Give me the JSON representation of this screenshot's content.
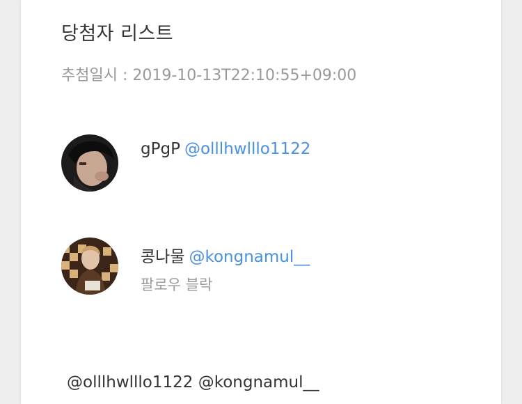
{
  "list": {
    "title": "당첨자 리스트",
    "draw_date": "추첨일시 : 2019-10-13T22:10:55+09:00"
  },
  "winners": [
    {
      "name": "gPgP",
      "handle": "@olllhwlllo1122",
      "note": ""
    },
    {
      "name": "콩나물",
      "handle": "@kongnamul__",
      "note": "팔로우 블락"
    }
  ],
  "mentions": "@olllhwlllo1122 @kongnamul__",
  "colors": {
    "handle": "#4a90e2",
    "text": "#333333",
    "muted": "#999999",
    "background": "#eeeeee",
    "card": "#ffffff"
  }
}
